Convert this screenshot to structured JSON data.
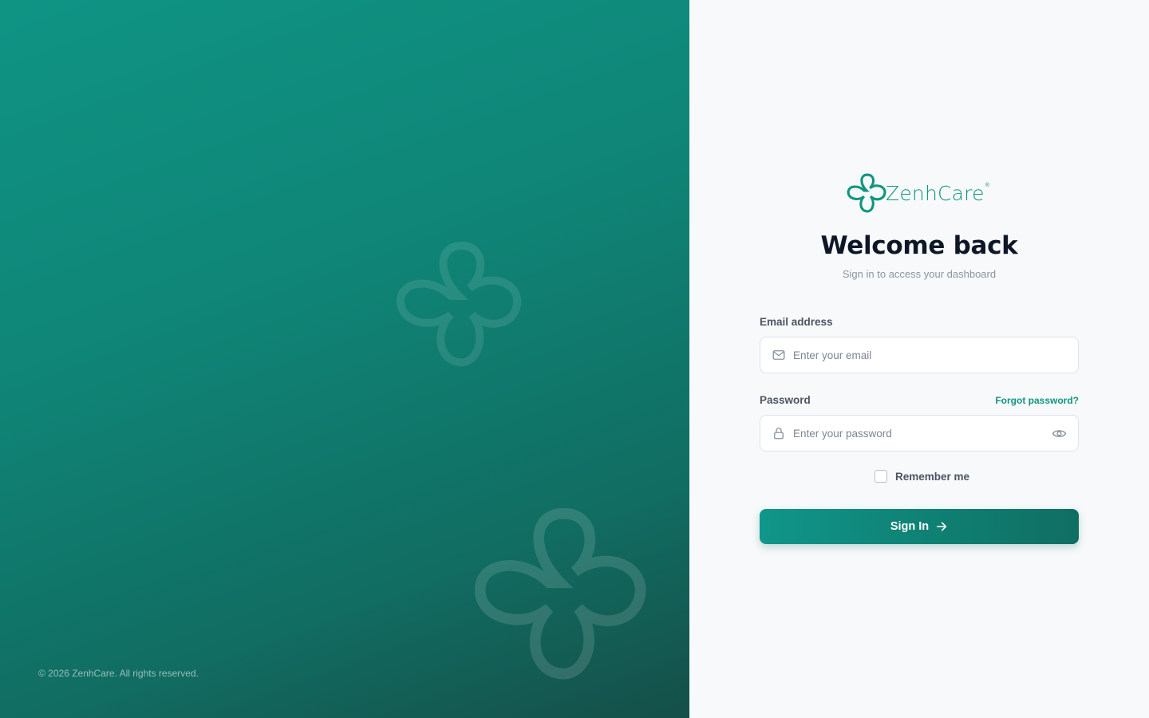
{
  "brand": {
    "name": "ZenhCare",
    "trademark": "®",
    "accent_color": "#11957f",
    "dark_color": "#0e1726"
  },
  "left_panel": {
    "copyright": "© 2026 ZenhCare. All rights reserved.",
    "decoration_icons": [
      "clover-logo-icon",
      "clover-logo-icon"
    ]
  },
  "login": {
    "title": "Welcome back",
    "subtitle": "Sign in to access your dashboard",
    "email": {
      "label": "Email address",
      "value": "",
      "placeholder": "Enter your email",
      "icon": "mail-icon"
    },
    "password": {
      "label": "Password",
      "value": "",
      "placeholder": "Enter your password",
      "icon": "lock-icon",
      "toggle_icon": "eye-icon"
    },
    "forgot_password": "Forgot password?",
    "remember_me": {
      "label": "Remember me",
      "checked": false
    },
    "submit": {
      "label": "Sign In",
      "icon": "arrow-right-icon"
    }
  }
}
